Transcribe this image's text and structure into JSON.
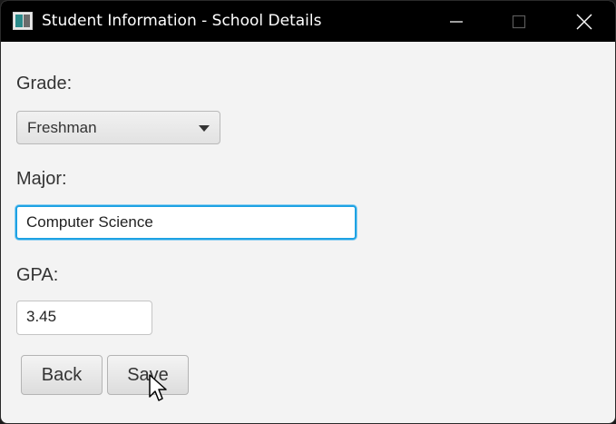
{
  "window": {
    "title": "Student Information - School Details",
    "controls": [
      "minimize-icon",
      "maximize-icon",
      "close-icon"
    ]
  },
  "form": {
    "grade": {
      "label": "Grade:",
      "selected": "Freshman"
    },
    "major": {
      "label": "Major:",
      "value": "Computer Science"
    },
    "gpa": {
      "label": "GPA:",
      "value": "3.45"
    }
  },
  "buttons": {
    "back": "Back",
    "save": "Save"
  },
  "colors": {
    "titlebar": "#000000",
    "window_bg": "#f3f3f3",
    "focus_ring": "#1ea2e3"
  }
}
